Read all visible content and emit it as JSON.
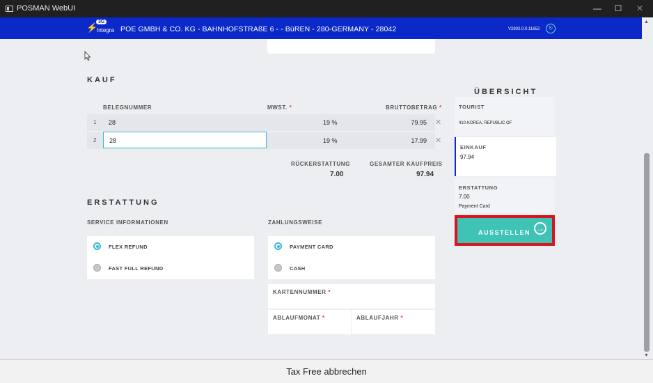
{
  "window": {
    "title": "POSMAN WebUI",
    "minimize": "—",
    "maximize": "☐",
    "close": "✕"
  },
  "header": {
    "logo_badge": "3G",
    "logo_text": "Integra",
    "company": "POE GMBH & CO. KG - BAHNHOFSTRAßE 6 - - BüREN - 280-GERMANY - 28042",
    "version": "V2802.0.0.11652",
    "accent_color": "#0a29c8"
  },
  "kauf": {
    "title": "KAUF",
    "columns": [
      "BELEGNUMMER",
      "MWST.",
      "BRUTTOBETRAG"
    ],
    "rows": [
      {
        "index": "1",
        "belegnummer": "28",
        "mwst": "19 %",
        "brutto": "79.95"
      },
      {
        "index": "2",
        "belegnummer": "28",
        "mwst": "19 %",
        "brutto": "17.99"
      }
    ],
    "rueckerstattung_label": "RÜCKERSTATTUNG",
    "rueckerstattung_value": "7.00",
    "gesamt_label": "GESAMTER KAUFPREIS",
    "gesamt_value": "97.94"
  },
  "erstattung": {
    "title": "ERSTATTUNG",
    "service_label": "SERVICE INFORMATIONEN",
    "service_options": [
      {
        "label": "FLEX REFUND",
        "selected": true
      },
      {
        "label": "FAST FULL REFUND",
        "selected": false
      }
    ],
    "payment_label": "ZAHLUNGSWEISE",
    "payment_options": [
      {
        "label": "PAYMENT CARD",
        "selected": true
      },
      {
        "label": "CASH",
        "selected": false
      }
    ],
    "kartennummer_label": "KARTENNUMMER",
    "ablaufmonat_label": "ABLAUFMONAT",
    "ablaufjahr_label": "ABLAUFJAHR",
    "required_mark": "*"
  },
  "overview": {
    "title": "ÜBERSICHT",
    "tourist_label": "TOURIST",
    "tourist_value": "410-KOREA, REPUBLIC OF",
    "einkauf_label": "EINKAUF",
    "einkauf_value": "97.94",
    "erstattung_label": "ERSTATTUNG",
    "erstattung_value": "7.00",
    "erstattung_method": "Payment Card",
    "action_button": "AUSSTELLEN",
    "button_color": "#3fc3b5",
    "highlight_color": "#d8151c"
  },
  "footer": {
    "cancel_label": "Tax Free abbrechen"
  }
}
